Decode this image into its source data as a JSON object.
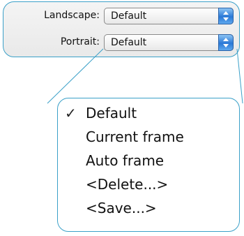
{
  "preferences": {
    "landscape": {
      "label": "Landscape:",
      "value": "Default"
    },
    "portrait": {
      "label": "Portrait:",
      "value": "Default"
    }
  },
  "menu": {
    "check_glyph": "✓",
    "selected_index": 0,
    "items": [
      {
        "label": "Default"
      },
      {
        "label": "Current frame"
      },
      {
        "label": "Auto frame"
      },
      {
        "label": "<Delete...>"
      },
      {
        "label": "<Save...>"
      }
    ]
  },
  "colors": {
    "accent": "#3aa0c8",
    "popup_arrow_blue": "#2a78d6"
  }
}
